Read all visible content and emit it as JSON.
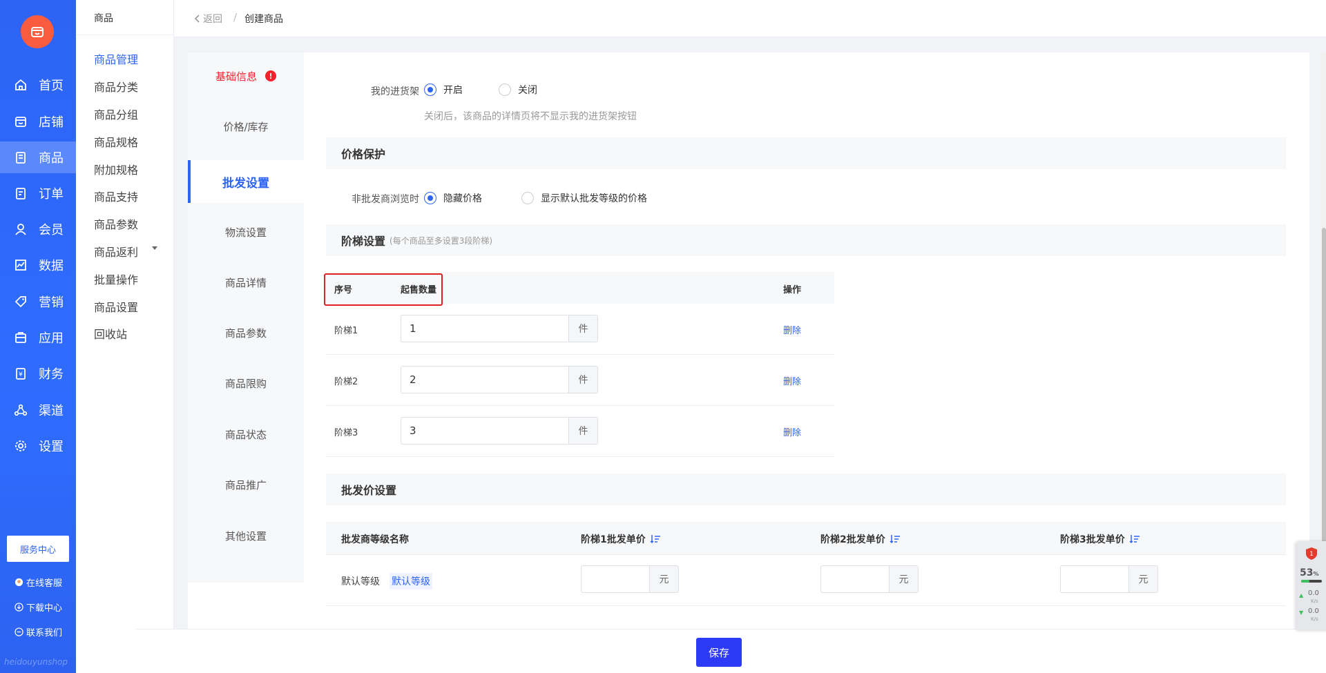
{
  "main_nav": {
    "items": [
      {
        "label": "首页",
        "icon": "home-icon"
      },
      {
        "label": "店铺",
        "icon": "store-icon"
      },
      {
        "label": "商品",
        "icon": "product-icon"
      },
      {
        "label": "订单",
        "icon": "order-icon"
      },
      {
        "label": "会员",
        "icon": "member-icon"
      },
      {
        "label": "数据",
        "icon": "chart-icon"
      },
      {
        "label": "营销",
        "icon": "tag-icon"
      },
      {
        "label": "应用",
        "icon": "app-icon"
      },
      {
        "label": "财务",
        "icon": "finance-icon"
      },
      {
        "label": "渠道",
        "icon": "channel-icon"
      },
      {
        "label": "设置",
        "icon": "gear-icon"
      }
    ],
    "service_center": "服务中心",
    "footer_links": [
      "在线客服",
      "下载中心",
      "联系我们"
    ],
    "watermark": "heidouyunshop"
  },
  "sub_nav": {
    "title": "商品",
    "items": [
      "商品管理",
      "商品分类",
      "商品分组",
      "商品规格",
      "附加规格",
      "商品支持",
      "商品参数",
      "商品返利",
      "批量操作",
      "商品设置",
      "回收站"
    ]
  },
  "topbar": {
    "back": "返回",
    "separator": "/",
    "crumb": "创建商品"
  },
  "tabs": [
    "基础信息",
    "价格/库存",
    "批发设置",
    "物流设置",
    "商品详情",
    "商品参数",
    "商品限购",
    "商品状态",
    "商品推广",
    "其他设置"
  ],
  "stock_shelf": {
    "label": "我的进货架",
    "options": [
      "开启",
      "关闭"
    ],
    "hint": "关闭后，该商品的详情页将不显示我的进货架按钮"
  },
  "price_protect": {
    "title": "价格保护",
    "label": "非批发商浏览时",
    "options": [
      "隐藏价格",
      "显示默认批发等级的价格"
    ]
  },
  "tier": {
    "title": "阶梯设置",
    "subtitle": "(每个商品至多设置3段阶梯)",
    "headers": {
      "index": "序号",
      "min_qty": "起售数量",
      "action": "操作"
    },
    "rows": [
      {
        "name": "阶梯1",
        "qty": "1",
        "unit": "件",
        "action": "删除"
      },
      {
        "name": "阶梯2",
        "qty": "2",
        "unit": "件",
        "action": "删除"
      },
      {
        "name": "阶梯3",
        "qty": "3",
        "unit": "件",
        "action": "删除"
      }
    ]
  },
  "wholesale_price": {
    "title": "批发价设置",
    "headers": [
      "批发商等级名称",
      "阶梯1批发单价",
      "阶梯2批发单价",
      "阶梯3批发单价"
    ],
    "row": {
      "name": "默认等级",
      "tag": "默认等级",
      "unit": "元"
    }
  },
  "save_label": "保存",
  "widget": {
    "badge": "1",
    "percent": "53",
    "percent_unit": "%",
    "up": "0.0",
    "down": "0.0",
    "rate_unit": "K/s"
  },
  "colors": {
    "primary": "#2d64f5",
    "error": "#f5222d",
    "logo": "#fb5c40"
  }
}
